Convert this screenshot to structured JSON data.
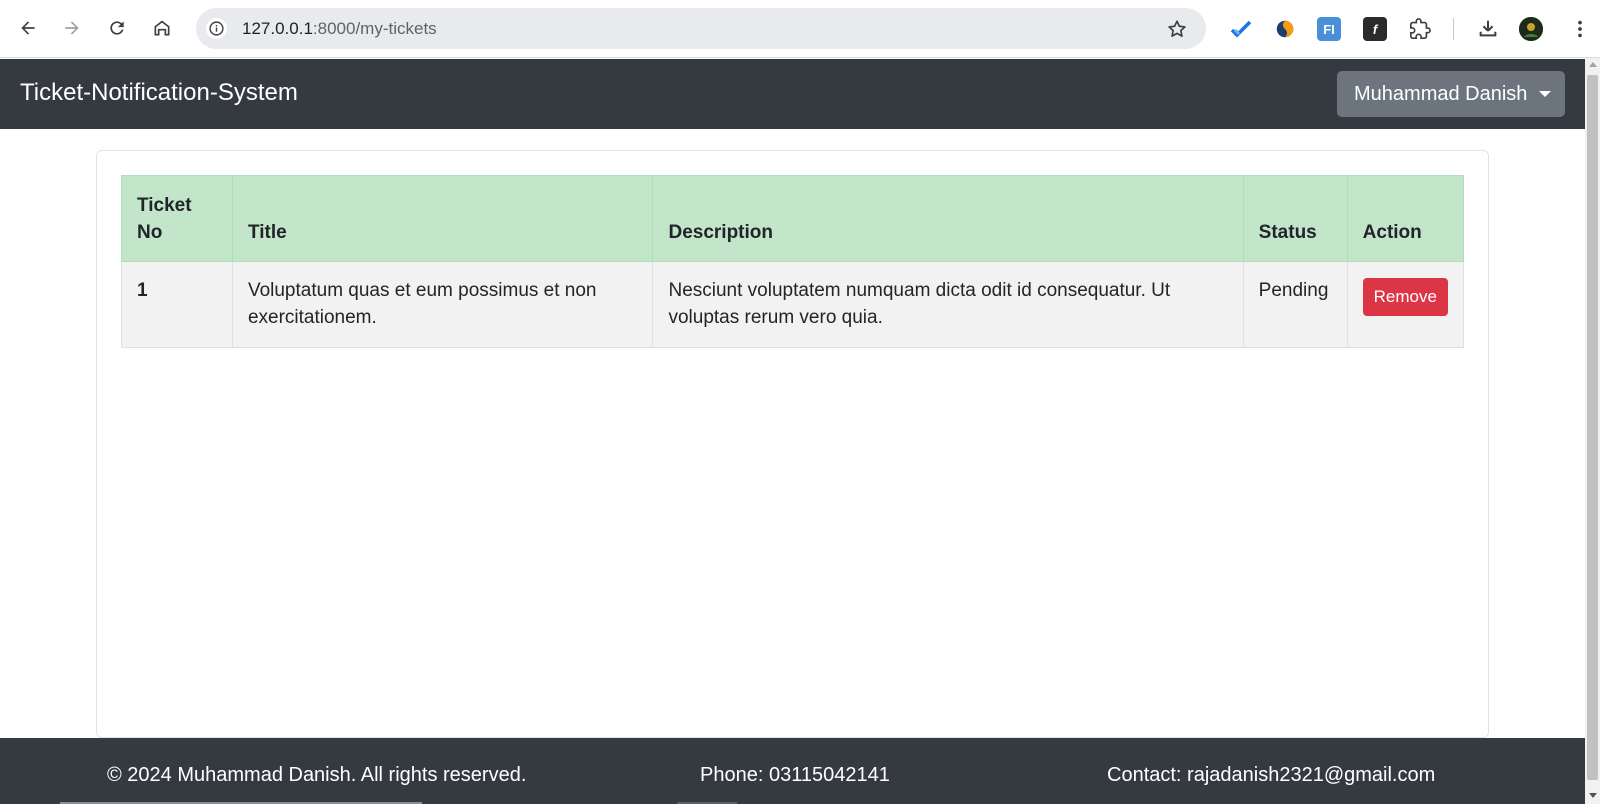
{
  "browser": {
    "url_host": "127.0.0.1",
    "url_path": ":8000/my-tickets"
  },
  "navbar": {
    "brand": "Ticket-Notification-System",
    "user_name": "Muhammad Danish"
  },
  "table": {
    "headers": {
      "ticket_no": "Ticket No",
      "title": "Title",
      "description": "Description",
      "status": "Status",
      "action": "Action"
    },
    "rows": [
      {
        "ticket_no": "1",
        "title": "Voluptatum quas et eum possimus et non exercitationem.",
        "description": "Nesciunt voluptatem numquam dicta odit id consequatur. Ut voluptas rerum vero quia.",
        "status": "Pending",
        "action_label": "Remove"
      }
    ]
  },
  "footer": {
    "copyright": "© 2024 Muhammad Danish. All rights reserved.",
    "phone": "Phone: 03115042141",
    "contact": "Contact: rajadanish2321@gmail.com"
  },
  "colors": {
    "navbar_bg": "#343a40",
    "header_row_bg": "#c3e6cb",
    "remove_button": "#dc3545",
    "user_button": "#6c757d"
  }
}
